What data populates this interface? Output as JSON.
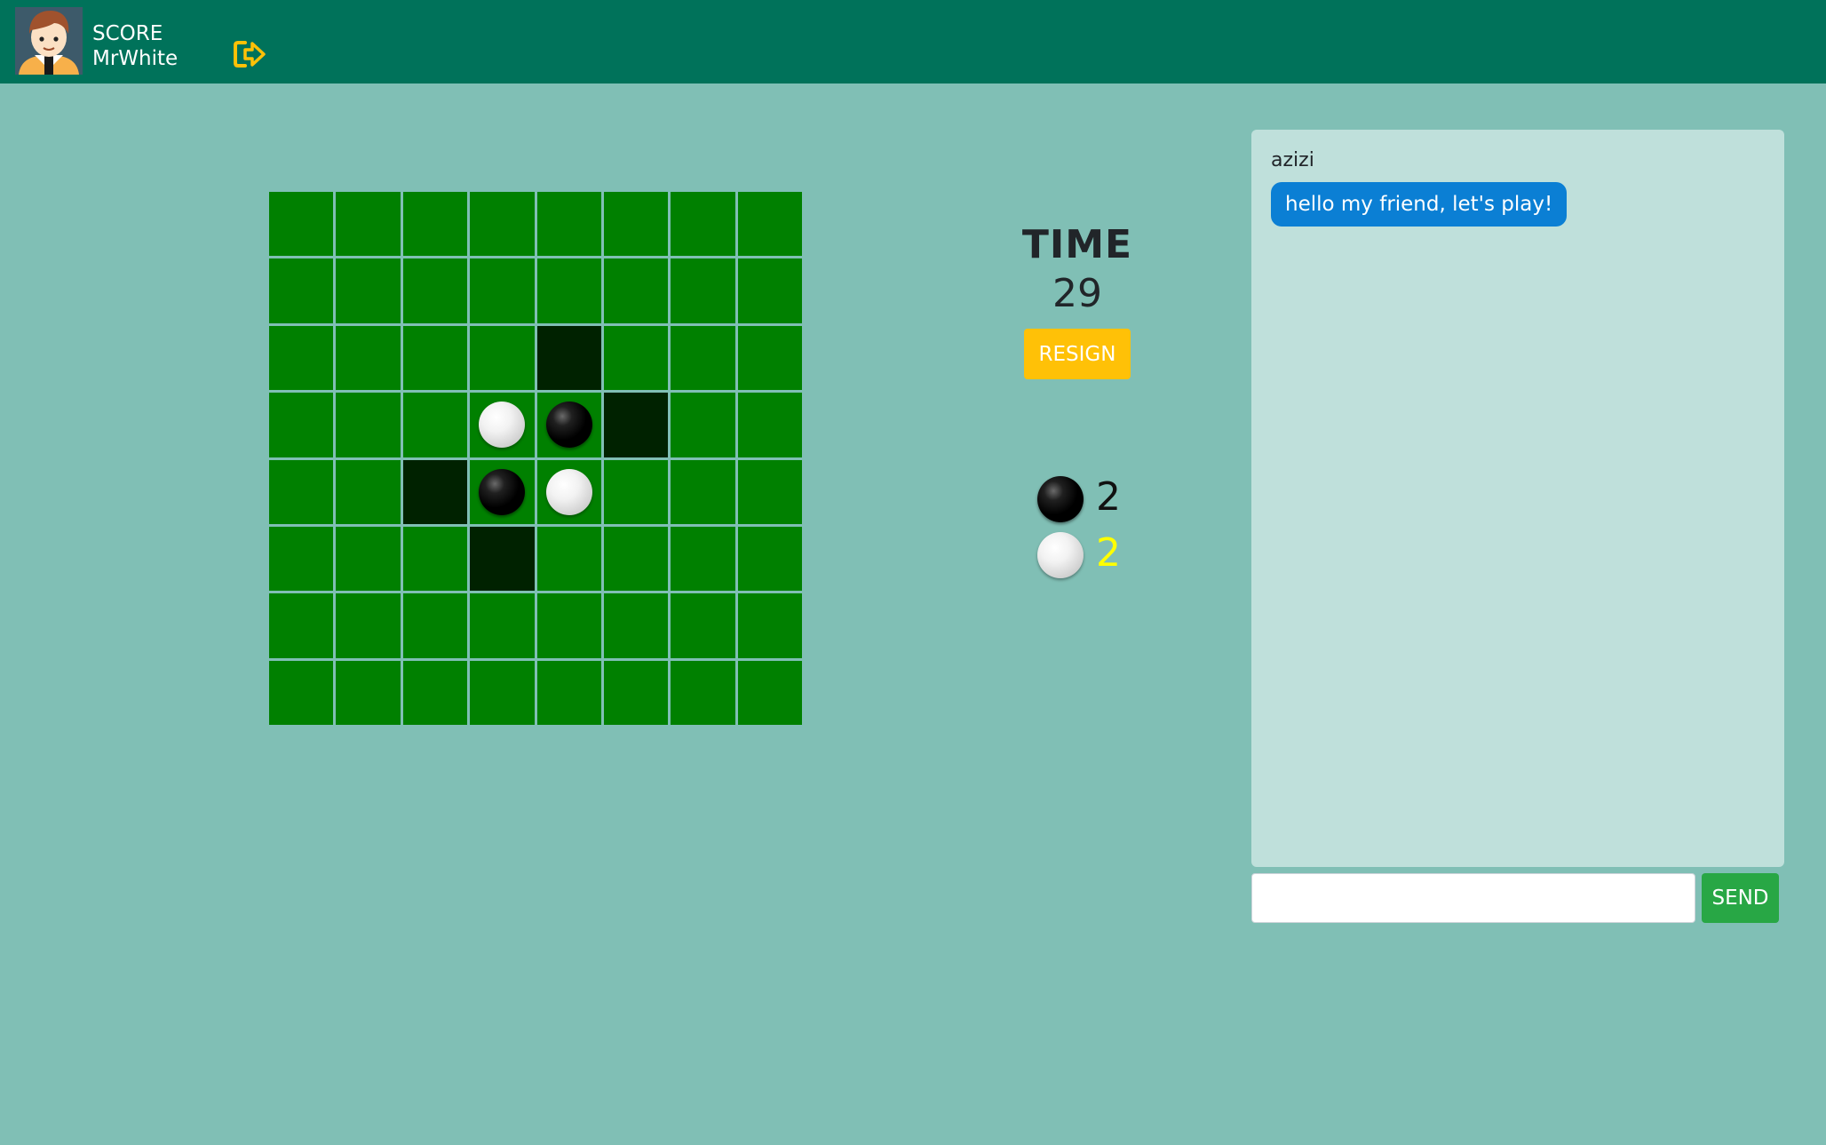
{
  "header": {
    "score_label": "SCORE",
    "username": "MrWhite",
    "avatar_icon": "boy-avatar-icon",
    "logout_icon": "sign-out-icon",
    "logout_color": "#ffc107"
  },
  "board": {
    "rows": 8,
    "cols": 8,
    "cells": [
      [
        "",
        "",
        "",
        "",
        "",
        "",
        "",
        ""
      ],
      [
        "",
        "",
        "",
        "",
        "",
        "",
        "",
        ""
      ],
      [
        "",
        "",
        "",
        "",
        "hint",
        "",
        "",
        ""
      ],
      [
        "",
        "",
        "",
        "white",
        "black",
        "hint",
        "",
        ""
      ],
      [
        "",
        "",
        "hint",
        "black",
        "white",
        "",
        "",
        ""
      ],
      [
        "",
        "",
        "",
        "hint",
        "",
        "",
        "",
        ""
      ],
      [
        "",
        "",
        "",
        "",
        "",
        "",
        "",
        ""
      ],
      [
        "",
        "",
        "",
        "",
        "",
        "",
        "",
        ""
      ]
    ],
    "colors": {
      "cell": "#008000",
      "hint": "#002200",
      "grid": "#80bfb5"
    }
  },
  "game": {
    "time_label": "TIME",
    "time_value": "29",
    "resign_label": "RESIGN",
    "scores": [
      {
        "player": "black",
        "value": "2",
        "color": "#111111"
      },
      {
        "player": "white",
        "value": "2",
        "color": "#ffff00"
      }
    ]
  },
  "chat": {
    "messages": [
      {
        "sender": "azizi",
        "text": "hello my friend, let's play!"
      }
    ],
    "input_value": "",
    "input_placeholder": "",
    "send_label": "SEND"
  }
}
